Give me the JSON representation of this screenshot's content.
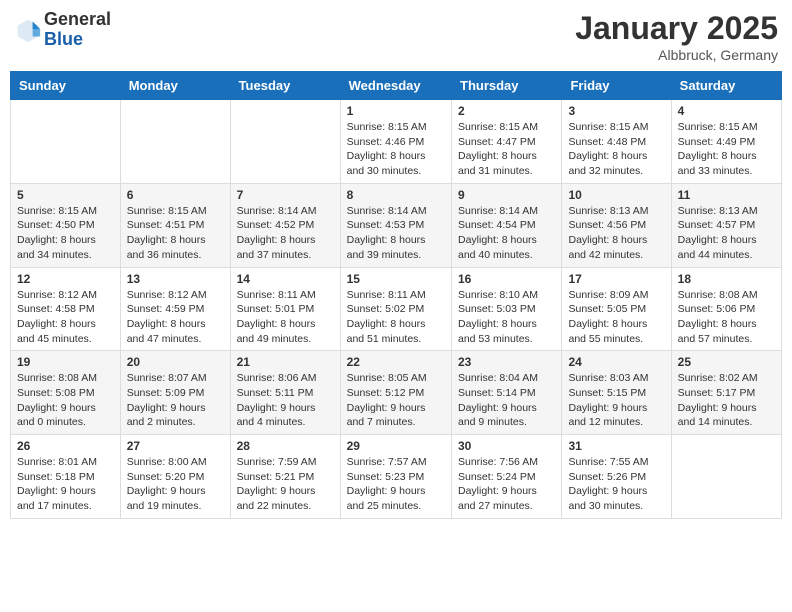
{
  "header": {
    "logo_general": "General",
    "logo_blue": "Blue",
    "month": "January 2025",
    "location": "Albbruck, Germany"
  },
  "weekdays": [
    "Sunday",
    "Monday",
    "Tuesday",
    "Wednesday",
    "Thursday",
    "Friday",
    "Saturday"
  ],
  "weeks": [
    [
      {
        "day": "",
        "info": ""
      },
      {
        "day": "",
        "info": ""
      },
      {
        "day": "",
        "info": ""
      },
      {
        "day": "1",
        "info": "Sunrise: 8:15 AM\nSunset: 4:46 PM\nDaylight: 8 hours\nand 30 minutes."
      },
      {
        "day": "2",
        "info": "Sunrise: 8:15 AM\nSunset: 4:47 PM\nDaylight: 8 hours\nand 31 minutes."
      },
      {
        "day": "3",
        "info": "Sunrise: 8:15 AM\nSunset: 4:48 PM\nDaylight: 8 hours\nand 32 minutes."
      },
      {
        "day": "4",
        "info": "Sunrise: 8:15 AM\nSunset: 4:49 PM\nDaylight: 8 hours\nand 33 minutes."
      }
    ],
    [
      {
        "day": "5",
        "info": "Sunrise: 8:15 AM\nSunset: 4:50 PM\nDaylight: 8 hours\nand 34 minutes."
      },
      {
        "day": "6",
        "info": "Sunrise: 8:15 AM\nSunset: 4:51 PM\nDaylight: 8 hours\nand 36 minutes."
      },
      {
        "day": "7",
        "info": "Sunrise: 8:14 AM\nSunset: 4:52 PM\nDaylight: 8 hours\nand 37 minutes."
      },
      {
        "day": "8",
        "info": "Sunrise: 8:14 AM\nSunset: 4:53 PM\nDaylight: 8 hours\nand 39 minutes."
      },
      {
        "day": "9",
        "info": "Sunrise: 8:14 AM\nSunset: 4:54 PM\nDaylight: 8 hours\nand 40 minutes."
      },
      {
        "day": "10",
        "info": "Sunrise: 8:13 AM\nSunset: 4:56 PM\nDaylight: 8 hours\nand 42 minutes."
      },
      {
        "day": "11",
        "info": "Sunrise: 8:13 AM\nSunset: 4:57 PM\nDaylight: 8 hours\nand 44 minutes."
      }
    ],
    [
      {
        "day": "12",
        "info": "Sunrise: 8:12 AM\nSunset: 4:58 PM\nDaylight: 8 hours\nand 45 minutes."
      },
      {
        "day": "13",
        "info": "Sunrise: 8:12 AM\nSunset: 4:59 PM\nDaylight: 8 hours\nand 47 minutes."
      },
      {
        "day": "14",
        "info": "Sunrise: 8:11 AM\nSunset: 5:01 PM\nDaylight: 8 hours\nand 49 minutes."
      },
      {
        "day": "15",
        "info": "Sunrise: 8:11 AM\nSunset: 5:02 PM\nDaylight: 8 hours\nand 51 minutes."
      },
      {
        "day": "16",
        "info": "Sunrise: 8:10 AM\nSunset: 5:03 PM\nDaylight: 8 hours\nand 53 minutes."
      },
      {
        "day": "17",
        "info": "Sunrise: 8:09 AM\nSunset: 5:05 PM\nDaylight: 8 hours\nand 55 minutes."
      },
      {
        "day": "18",
        "info": "Sunrise: 8:08 AM\nSunset: 5:06 PM\nDaylight: 8 hours\nand 57 minutes."
      }
    ],
    [
      {
        "day": "19",
        "info": "Sunrise: 8:08 AM\nSunset: 5:08 PM\nDaylight: 9 hours\nand 0 minutes."
      },
      {
        "day": "20",
        "info": "Sunrise: 8:07 AM\nSunset: 5:09 PM\nDaylight: 9 hours\nand 2 minutes."
      },
      {
        "day": "21",
        "info": "Sunrise: 8:06 AM\nSunset: 5:11 PM\nDaylight: 9 hours\nand 4 minutes."
      },
      {
        "day": "22",
        "info": "Sunrise: 8:05 AM\nSunset: 5:12 PM\nDaylight: 9 hours\nand 7 minutes."
      },
      {
        "day": "23",
        "info": "Sunrise: 8:04 AM\nSunset: 5:14 PM\nDaylight: 9 hours\nand 9 minutes."
      },
      {
        "day": "24",
        "info": "Sunrise: 8:03 AM\nSunset: 5:15 PM\nDaylight: 9 hours\nand 12 minutes."
      },
      {
        "day": "25",
        "info": "Sunrise: 8:02 AM\nSunset: 5:17 PM\nDaylight: 9 hours\nand 14 minutes."
      }
    ],
    [
      {
        "day": "26",
        "info": "Sunrise: 8:01 AM\nSunset: 5:18 PM\nDaylight: 9 hours\nand 17 minutes."
      },
      {
        "day": "27",
        "info": "Sunrise: 8:00 AM\nSunset: 5:20 PM\nDaylight: 9 hours\nand 19 minutes."
      },
      {
        "day": "28",
        "info": "Sunrise: 7:59 AM\nSunset: 5:21 PM\nDaylight: 9 hours\nand 22 minutes."
      },
      {
        "day": "29",
        "info": "Sunrise: 7:57 AM\nSunset: 5:23 PM\nDaylight: 9 hours\nand 25 minutes."
      },
      {
        "day": "30",
        "info": "Sunrise: 7:56 AM\nSunset: 5:24 PM\nDaylight: 9 hours\nand 27 minutes."
      },
      {
        "day": "31",
        "info": "Sunrise: 7:55 AM\nSunset: 5:26 PM\nDaylight: 9 hours\nand 30 minutes."
      },
      {
        "day": "",
        "info": ""
      }
    ]
  ]
}
